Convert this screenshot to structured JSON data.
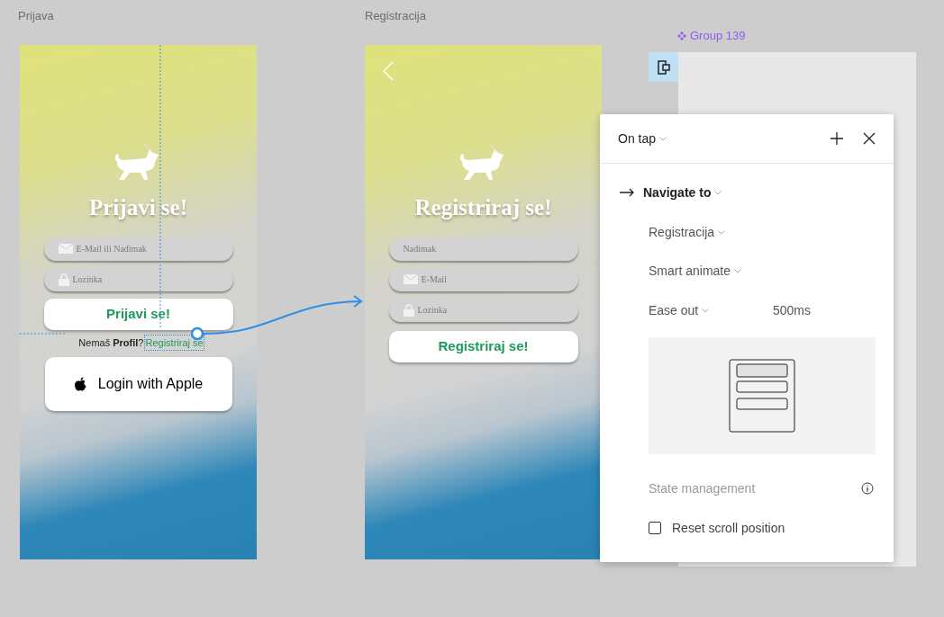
{
  "login_frame": {
    "label": "Prijava",
    "title": "Prijavi se!",
    "fields": [
      {
        "placeholder": "E-Mail ili Nadimak",
        "kind": "mail"
      },
      {
        "placeholder": "Lozinka",
        "kind": "lock"
      }
    ],
    "submit": "Prijavi se!",
    "prompt": "Nemaš **Profil**?",
    "link": "Registriraj se",
    "apple_button": "Login with Apple"
  },
  "register_frame": {
    "label": "Registracija",
    "title": "Registriraj se!",
    "fields": [
      {
        "placeholder": "Nadimak",
        "kind": "text"
      },
      {
        "placeholder": "E-Mail",
        "kind": "mail"
      },
      {
        "placeholder": "Lozinka",
        "kind": "lock"
      }
    ],
    "submit": "Registriraj se!"
  },
  "group": {
    "label": "Group 139"
  },
  "interaction_panel": {
    "trigger": "On tap",
    "action": "Navigate to",
    "destination": "Registracija",
    "animation": "Smart animate",
    "easing": "Ease out",
    "duration": "500ms",
    "section_label": "State management",
    "options": [
      {
        "label": "Reset scroll position",
        "checked": false
      }
    ]
  }
}
